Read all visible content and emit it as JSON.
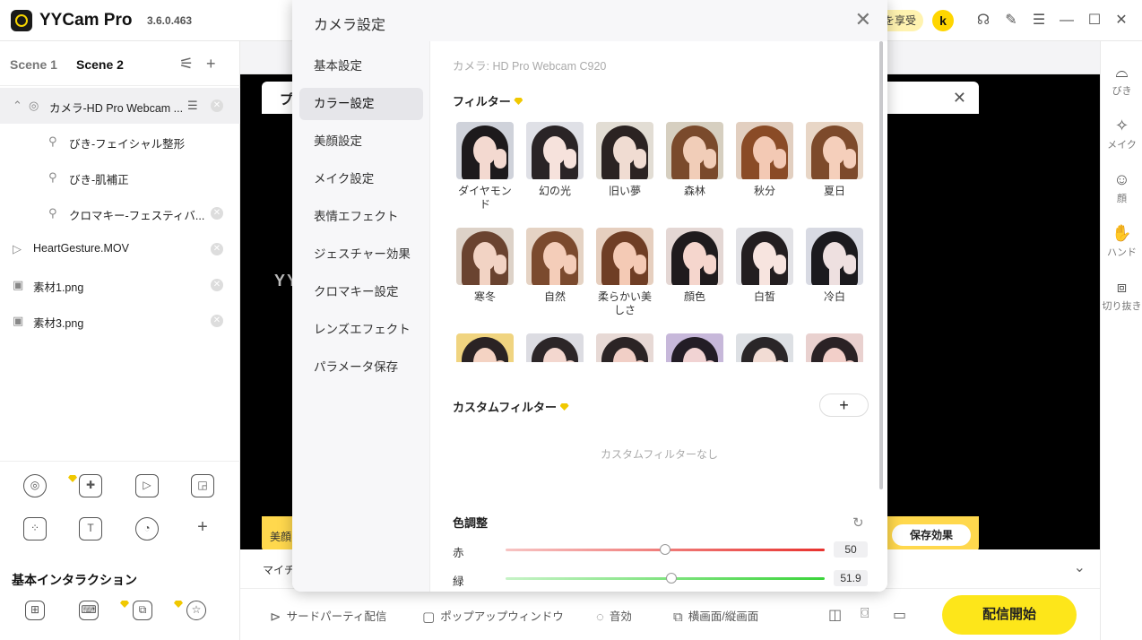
{
  "app": {
    "name": "YYCam Pro",
    "version": "3.6.0.463",
    "promo": "を享受",
    "avatar": "k"
  },
  "left_panel": {
    "scenes": [
      "Scene 1",
      "Scene 2"
    ],
    "layers": [
      {
        "label": "カメラ-HD Pro Webcam ..."
      },
      {
        "label": "びき-フェイシャル整形"
      },
      {
        "label": "びき-肌補正"
      },
      {
        "label": "クロマキー-フェスティバ..."
      },
      {
        "label": "HeartGesture.MOV"
      },
      {
        "label": "素材1.png"
      },
      {
        "label": "素材3.png"
      }
    ],
    "interaction_title": "基本インタラクション"
  },
  "right_bar": [
    {
      "label": "びき",
      "icon": "beauty-icon"
    },
    {
      "label": "メイク",
      "icon": "makeup-icon"
    },
    {
      "label": "顔",
      "icon": "face-icon"
    },
    {
      "label": "ハンド",
      "icon": "hand-icon"
    },
    {
      "label": "切り抜き",
      "icon": "cutout-icon"
    }
  ],
  "preview": {
    "sub_title": "プ",
    "watermark": "YY",
    "beauty_label": "美顔",
    "save_effect": "保存効果",
    "mic_label": "マイチ"
  },
  "bottom_bar": {
    "third_party": "サードパーティ配信",
    "popup": "ポップアップウィンドウ",
    "audio": "音効",
    "orientation": "横画面/縦画面",
    "go_live": "配信開始"
  },
  "modal": {
    "title": "カメラ設定",
    "nav": [
      "基本設定",
      "カラー設定",
      "美顔設定",
      "メイク設定",
      "表情エフェクト",
      "ジェスチャー効果",
      "クロマキー設定",
      "レンズエフェクト",
      "パラメータ保存"
    ],
    "active_nav": "カラー設定",
    "camera_name": "カメラ: HD Pro Webcam C920",
    "filter_title": "フィルター",
    "filters": [
      {
        "label": "ダイヤモンド",
        "skin": "#f3d9d0",
        "hair": "#1d1a1c",
        "bg": "#cfd2da"
      },
      {
        "label": "幻の光",
        "skin": "#f6e2dc",
        "hair": "#2a2426",
        "bg": "#dfe0e6"
      },
      {
        "label": "旧い夢",
        "skin": "#f0dcd2",
        "hair": "#2b2322",
        "bg": "#e2ddd4"
      },
      {
        "label": "森林",
        "skin": "#f1cdb8",
        "hair": "#7a4a2c",
        "bg": "#d6cfc0"
      },
      {
        "label": "秋分",
        "skin": "#f3c9b4",
        "hair": "#8a4b26",
        "bg": "#e2cfc0"
      },
      {
        "label": "夏日",
        "skin": "#f5cfbb",
        "hair": "#7d4a2b",
        "bg": "#e8d6c6"
      },
      {
        "label": "寒冬",
        "skin": "#f2d3c4",
        "hair": "#6a4330",
        "bg": "#ddd2c8"
      },
      {
        "label": "自然",
        "skin": "#f4cdb9",
        "hair": "#7b4a2e",
        "bg": "#e5d3c4"
      },
      {
        "label": "柔らかい美しさ",
        "skin": "#f4cab5",
        "hair": "#6f3e25",
        "bg": "#e6cfbf"
      },
      {
        "label": "顔色",
        "skin": "#f5d6cd",
        "hair": "#1f1b1d",
        "bg": "#e4d7d4"
      },
      {
        "label": "白皙",
        "skin": "#f7e4df",
        "hair": "#231e20",
        "bg": "#e2e2e6"
      },
      {
        "label": "冷白",
        "skin": "#eee0e0",
        "hair": "#1b1a1e",
        "bg": "#d8dae3"
      },
      {
        "label": "",
        "skin": "#f4d3c3",
        "hair": "#2a2324",
        "bg": "#f0d480"
      },
      {
        "label": "",
        "skin": "#f3d7cf",
        "hair": "#2c2628",
        "bg": "#dcdce2"
      },
      {
        "label": "",
        "skin": "#f1cfc6",
        "hair": "#2b2425",
        "bg": "#e7d9d5"
      },
      {
        "label": "",
        "skin": "#f1d3d3",
        "hair": "#231d26",
        "bg": "#c7b8da"
      },
      {
        "label": "",
        "skin": "#f2dcd4",
        "hair": "#2a2628",
        "bg": "#dde0e4"
      },
      {
        "label": "",
        "skin": "#f2cfc9",
        "hair": "#2a2225",
        "bg": "#e9d1cf"
      }
    ],
    "custom_filter_title": "カスタムフィルター",
    "custom_add": "+",
    "no_custom": "カスタムフィルターなし",
    "color_adjust_title": "色調整",
    "sliders": [
      {
        "label": "赤",
        "value": "50",
        "fraction": 0.5,
        "color": "#e8322e",
        "light": "#f7c4c3"
      },
      {
        "label": "緑",
        "value": "51.9",
        "fraction": 0.519,
        "color": "#3ad43a",
        "light": "#c7f3c7"
      }
    ]
  },
  "colors": {
    "accent": "#fde61a",
    "badge": "#f0c800"
  }
}
